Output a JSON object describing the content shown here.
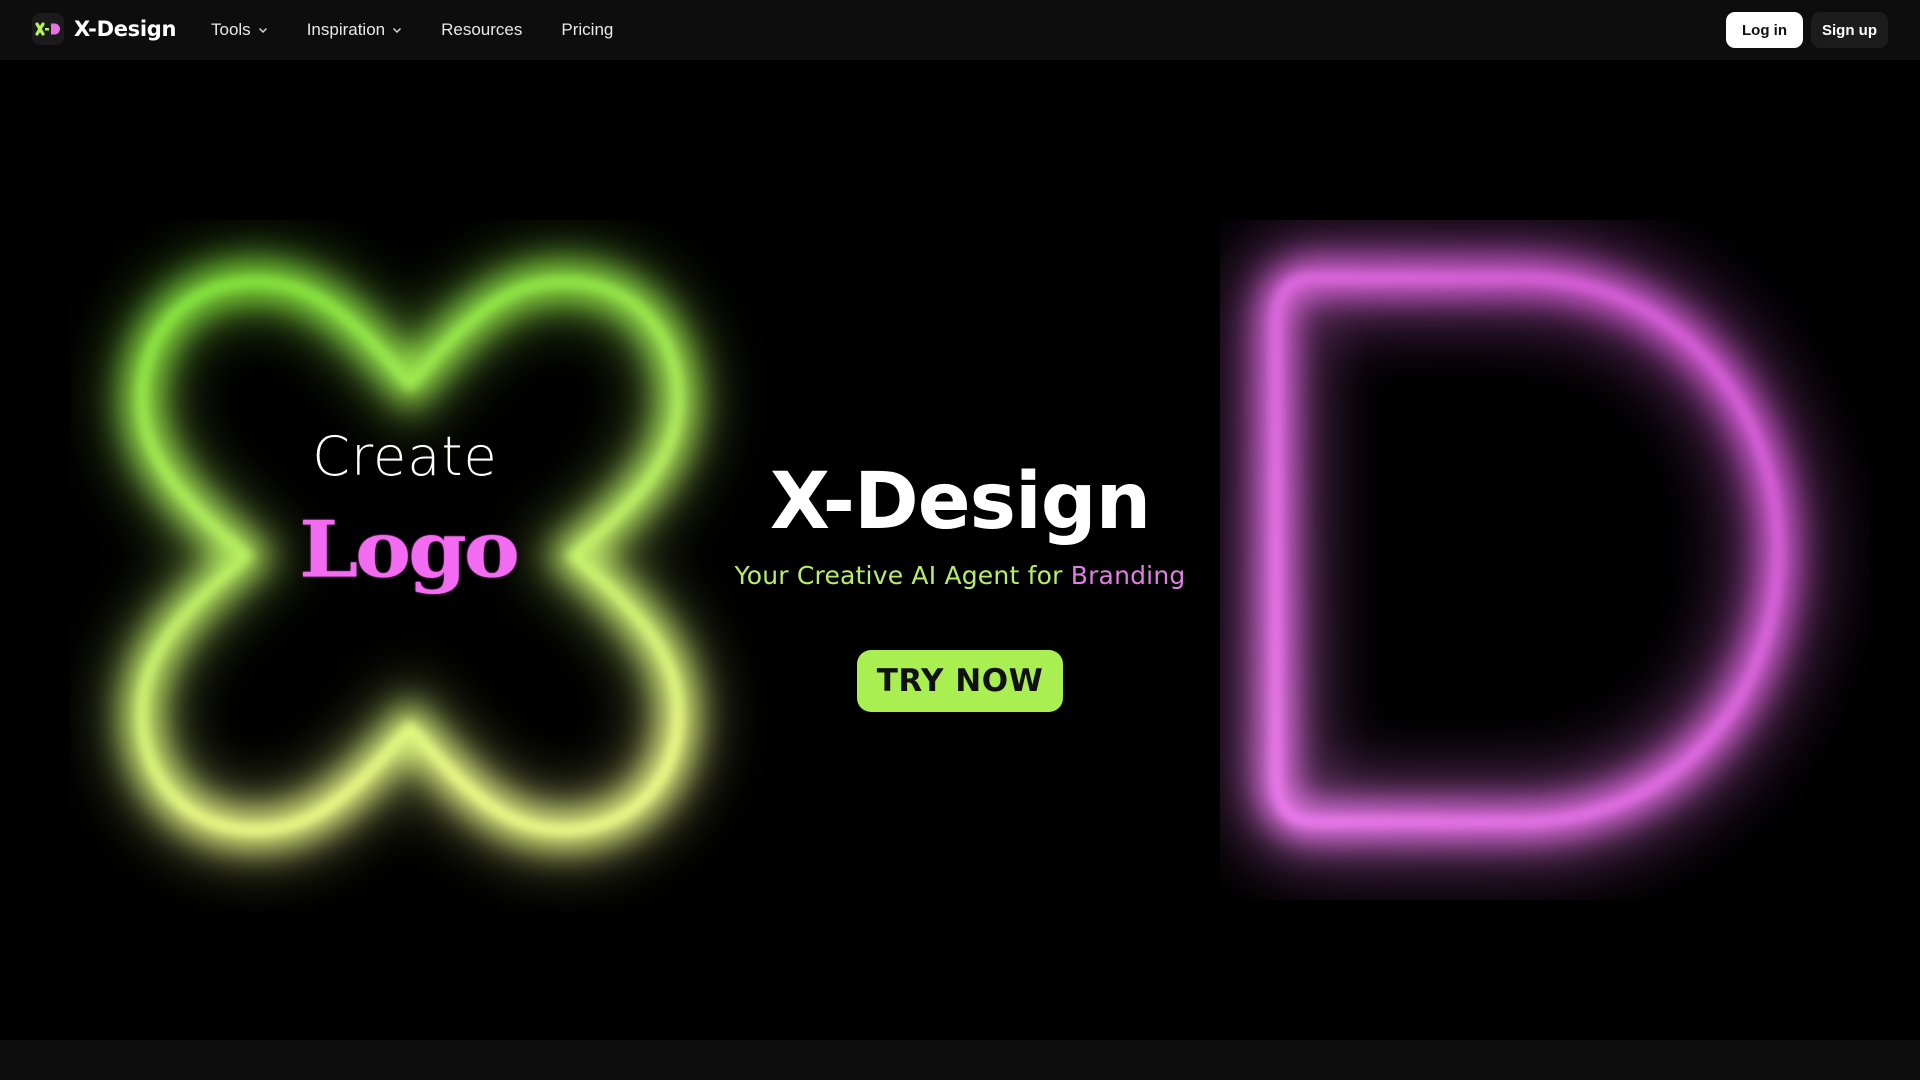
{
  "header": {
    "brand_name": "X-Design",
    "brand_mark_letters": "X·D",
    "nav": [
      {
        "label": "Tools",
        "has_dropdown": true
      },
      {
        "label": "Inspiration",
        "has_dropdown": true
      },
      {
        "label": "Resources",
        "has_dropdown": false
      },
      {
        "label": "Pricing",
        "has_dropdown": false
      }
    ],
    "login_label": "Log in",
    "signup_label": "Sign up"
  },
  "hero": {
    "create_text": "Create",
    "rotating_word": "Logo",
    "title": "X-Design",
    "subtitle_part1": "Your Creative AI Agent for",
    "subtitle_part2": "Branding",
    "cta_label": "TRY NOW"
  },
  "colors": {
    "accent_green": "#a9ef52",
    "accent_pink": "#f36bf0",
    "background": "#000000"
  },
  "icons": [
    "brand-logo-icon",
    "chevron-down-icon",
    "glow-x-shape",
    "glow-d-shape"
  ]
}
